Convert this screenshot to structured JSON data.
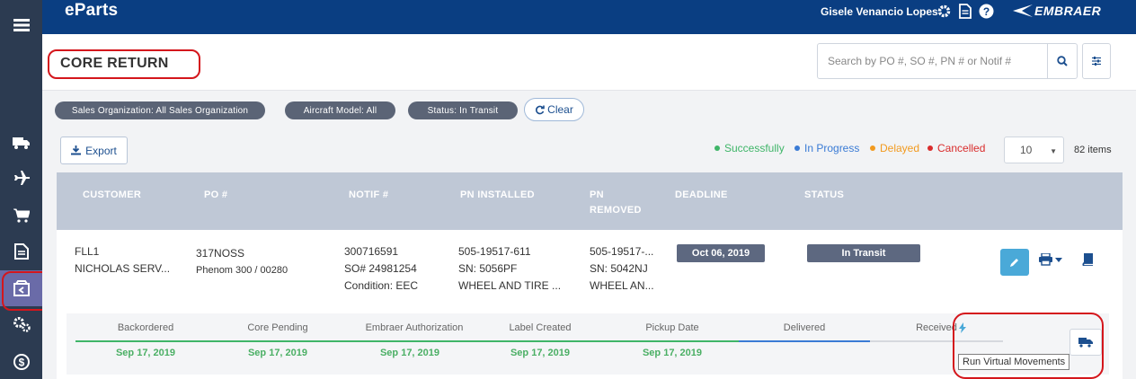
{
  "app": {
    "title": "eParts",
    "user": "Gisele Venancio Lopes",
    "logo": "EMBRAER"
  },
  "sidebar": {
    "items": [
      {
        "icon": "menu-icon"
      },
      {
        "icon": "truck-icon"
      },
      {
        "icon": "plane-icon"
      },
      {
        "icon": "cart-icon"
      },
      {
        "icon": "document-icon"
      },
      {
        "icon": "core-return-icon"
      },
      {
        "icon": "gears-icon"
      },
      {
        "icon": "dollar-icon"
      }
    ]
  },
  "header": {
    "title": "CORE RETURN",
    "search_placeholder": "Search by PO #, SO #, PN # or Notif #"
  },
  "filters": {
    "chips": [
      "Sales Organization: All Sales Organization",
      "Aircraft Model: All",
      "Status: In Transit"
    ],
    "clear_label": "Clear"
  },
  "toolbar": {
    "export_label": "Export",
    "legend": [
      {
        "label": "Successfully",
        "color": "#3fb568"
      },
      {
        "label": "In Progress",
        "color": "#3a7bd5"
      },
      {
        "label": "Delayed",
        "color": "#f29a1f"
      },
      {
        "label": "Cancelled",
        "color": "#d92c2c"
      }
    ],
    "page_size": "10",
    "items_count": "82 items"
  },
  "table": {
    "columns": [
      "CUSTOMER",
      "PO #",
      "NOTIF #",
      "PN INSTALLED",
      "PN",
      "REMOVED",
      "DEADLINE",
      "STATUS"
    ],
    "row": {
      "customer_code": "FLL1",
      "customer_name": "NICHOLAS SERV...",
      "po": "317NOSS",
      "po_detail": "Phenom 300 / 00280",
      "notif": "300716591",
      "so": "SO# 24981254",
      "condition": "Condition: EEC",
      "pn_installed": "505-19517-611",
      "pn_installed_sn": "SN: 5056PF",
      "pn_installed_desc": "WHEEL AND TIRE ...",
      "pn_removed": "505-19517-...",
      "pn_removed_sn": "SN: 5042NJ",
      "pn_removed_desc": "WHEEL AN...",
      "deadline": "Oct 06, 2019",
      "status": "In Transit"
    }
  },
  "progress": {
    "steps": [
      {
        "label": "Backordered",
        "date": "Sep 17, 2019"
      },
      {
        "label": "Core Pending",
        "date": "Sep 17, 2019"
      },
      {
        "label": "Embraer Authorization",
        "date": "Sep 17, 2019"
      },
      {
        "label": "Label Created",
        "date": "Sep 17, 2019"
      },
      {
        "label": "Pickup Date",
        "date": "Sep 17, 2019"
      },
      {
        "label": "Delivered",
        "date": ""
      },
      {
        "label": "Received",
        "date": ""
      }
    ],
    "completed_color": "#3fb568",
    "active_color": "#3a7bd5"
  },
  "tooltip": {
    "text": "Run Virtual Movements"
  }
}
